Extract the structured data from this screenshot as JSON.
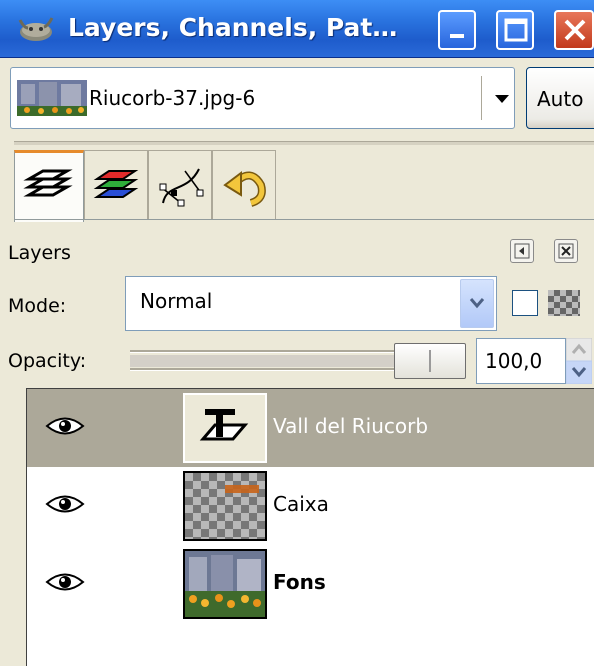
{
  "window": {
    "title": "Layers, Channels, Pat…",
    "buttons": [
      "minimize",
      "maximize",
      "close"
    ],
    "accent_color": "#2a74e0"
  },
  "image_selector": {
    "value": "Riucorb-37.jpg-6",
    "auto_label": "Auto"
  },
  "tabs": [
    {
      "icon": "layers-icon",
      "active": true
    },
    {
      "icon": "channels-icon",
      "active": false
    },
    {
      "icon": "paths-icon",
      "active": false
    },
    {
      "icon": "undo-history-icon",
      "active": false
    }
  ],
  "panel": {
    "title": "Layers",
    "mode_label": "Mode:",
    "mode_value": "Normal",
    "opacity_label": "Opacity:",
    "opacity_value": "100,0",
    "opacity_level": 1.0
  },
  "layers": [
    {
      "name": "Vall del Riucorb",
      "visible": true,
      "selected": true,
      "type": "text"
    },
    {
      "name": "Caixa",
      "visible": true,
      "selected": false,
      "type": "transparent"
    },
    {
      "name": "Fons",
      "visible": true,
      "selected": false,
      "type": "image",
      "bold": true
    }
  ]
}
